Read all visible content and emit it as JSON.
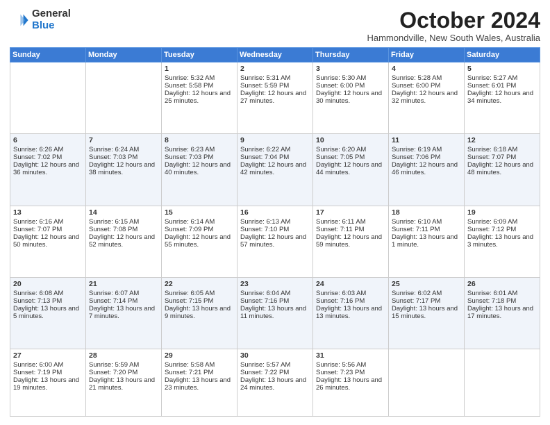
{
  "logo": {
    "general": "General",
    "blue": "Blue"
  },
  "title": "October 2024",
  "location": "Hammondville, New South Wales, Australia",
  "days": [
    "Sunday",
    "Monday",
    "Tuesday",
    "Wednesday",
    "Thursday",
    "Friday",
    "Saturday"
  ],
  "weeks": [
    [
      {
        "num": "",
        "sunrise": "",
        "sunset": "",
        "daylight": ""
      },
      {
        "num": "",
        "sunrise": "",
        "sunset": "",
        "daylight": ""
      },
      {
        "num": "1",
        "sunrise": "Sunrise: 5:32 AM",
        "sunset": "Sunset: 5:58 PM",
        "daylight": "Daylight: 12 hours and 25 minutes."
      },
      {
        "num": "2",
        "sunrise": "Sunrise: 5:31 AM",
        "sunset": "Sunset: 5:59 PM",
        "daylight": "Daylight: 12 hours and 27 minutes."
      },
      {
        "num": "3",
        "sunrise": "Sunrise: 5:30 AM",
        "sunset": "Sunset: 6:00 PM",
        "daylight": "Daylight: 12 hours and 30 minutes."
      },
      {
        "num": "4",
        "sunrise": "Sunrise: 5:28 AM",
        "sunset": "Sunset: 6:00 PM",
        "daylight": "Daylight: 12 hours and 32 minutes."
      },
      {
        "num": "5",
        "sunrise": "Sunrise: 5:27 AM",
        "sunset": "Sunset: 6:01 PM",
        "daylight": "Daylight: 12 hours and 34 minutes."
      }
    ],
    [
      {
        "num": "6",
        "sunrise": "Sunrise: 6:26 AM",
        "sunset": "Sunset: 7:02 PM",
        "daylight": "Daylight: 12 hours and 36 minutes."
      },
      {
        "num": "7",
        "sunrise": "Sunrise: 6:24 AM",
        "sunset": "Sunset: 7:03 PM",
        "daylight": "Daylight: 12 hours and 38 minutes."
      },
      {
        "num": "8",
        "sunrise": "Sunrise: 6:23 AM",
        "sunset": "Sunset: 7:03 PM",
        "daylight": "Daylight: 12 hours and 40 minutes."
      },
      {
        "num": "9",
        "sunrise": "Sunrise: 6:22 AM",
        "sunset": "Sunset: 7:04 PM",
        "daylight": "Daylight: 12 hours and 42 minutes."
      },
      {
        "num": "10",
        "sunrise": "Sunrise: 6:20 AM",
        "sunset": "Sunset: 7:05 PM",
        "daylight": "Daylight: 12 hours and 44 minutes."
      },
      {
        "num": "11",
        "sunrise": "Sunrise: 6:19 AM",
        "sunset": "Sunset: 7:06 PM",
        "daylight": "Daylight: 12 hours and 46 minutes."
      },
      {
        "num": "12",
        "sunrise": "Sunrise: 6:18 AM",
        "sunset": "Sunset: 7:07 PM",
        "daylight": "Daylight: 12 hours and 48 minutes."
      }
    ],
    [
      {
        "num": "13",
        "sunrise": "Sunrise: 6:16 AM",
        "sunset": "Sunset: 7:07 PM",
        "daylight": "Daylight: 12 hours and 50 minutes."
      },
      {
        "num": "14",
        "sunrise": "Sunrise: 6:15 AM",
        "sunset": "Sunset: 7:08 PM",
        "daylight": "Daylight: 12 hours and 52 minutes."
      },
      {
        "num": "15",
        "sunrise": "Sunrise: 6:14 AM",
        "sunset": "Sunset: 7:09 PM",
        "daylight": "Daylight: 12 hours and 55 minutes."
      },
      {
        "num": "16",
        "sunrise": "Sunrise: 6:13 AM",
        "sunset": "Sunset: 7:10 PM",
        "daylight": "Daylight: 12 hours and 57 minutes."
      },
      {
        "num": "17",
        "sunrise": "Sunrise: 6:11 AM",
        "sunset": "Sunset: 7:11 PM",
        "daylight": "Daylight: 12 hours and 59 minutes."
      },
      {
        "num": "18",
        "sunrise": "Sunrise: 6:10 AM",
        "sunset": "Sunset: 7:11 PM",
        "daylight": "Daylight: 13 hours and 1 minute."
      },
      {
        "num": "19",
        "sunrise": "Sunrise: 6:09 AM",
        "sunset": "Sunset: 7:12 PM",
        "daylight": "Daylight: 13 hours and 3 minutes."
      }
    ],
    [
      {
        "num": "20",
        "sunrise": "Sunrise: 6:08 AM",
        "sunset": "Sunset: 7:13 PM",
        "daylight": "Daylight: 13 hours and 5 minutes."
      },
      {
        "num": "21",
        "sunrise": "Sunrise: 6:07 AM",
        "sunset": "Sunset: 7:14 PM",
        "daylight": "Daylight: 13 hours and 7 minutes."
      },
      {
        "num": "22",
        "sunrise": "Sunrise: 6:05 AM",
        "sunset": "Sunset: 7:15 PM",
        "daylight": "Daylight: 13 hours and 9 minutes."
      },
      {
        "num": "23",
        "sunrise": "Sunrise: 6:04 AM",
        "sunset": "Sunset: 7:16 PM",
        "daylight": "Daylight: 13 hours and 11 minutes."
      },
      {
        "num": "24",
        "sunrise": "Sunrise: 6:03 AM",
        "sunset": "Sunset: 7:16 PM",
        "daylight": "Daylight: 13 hours and 13 minutes."
      },
      {
        "num": "25",
        "sunrise": "Sunrise: 6:02 AM",
        "sunset": "Sunset: 7:17 PM",
        "daylight": "Daylight: 13 hours and 15 minutes."
      },
      {
        "num": "26",
        "sunrise": "Sunrise: 6:01 AM",
        "sunset": "Sunset: 7:18 PM",
        "daylight": "Daylight: 13 hours and 17 minutes."
      }
    ],
    [
      {
        "num": "27",
        "sunrise": "Sunrise: 6:00 AM",
        "sunset": "Sunset: 7:19 PM",
        "daylight": "Daylight: 13 hours and 19 minutes."
      },
      {
        "num": "28",
        "sunrise": "Sunrise: 5:59 AM",
        "sunset": "Sunset: 7:20 PM",
        "daylight": "Daylight: 13 hours and 21 minutes."
      },
      {
        "num": "29",
        "sunrise": "Sunrise: 5:58 AM",
        "sunset": "Sunset: 7:21 PM",
        "daylight": "Daylight: 13 hours and 23 minutes."
      },
      {
        "num": "30",
        "sunrise": "Sunrise: 5:57 AM",
        "sunset": "Sunset: 7:22 PM",
        "daylight": "Daylight: 13 hours and 24 minutes."
      },
      {
        "num": "31",
        "sunrise": "Sunrise: 5:56 AM",
        "sunset": "Sunset: 7:23 PM",
        "daylight": "Daylight: 13 hours and 26 minutes."
      },
      {
        "num": "",
        "sunrise": "",
        "sunset": "",
        "daylight": ""
      },
      {
        "num": "",
        "sunrise": "",
        "sunset": "",
        "daylight": ""
      }
    ]
  ]
}
